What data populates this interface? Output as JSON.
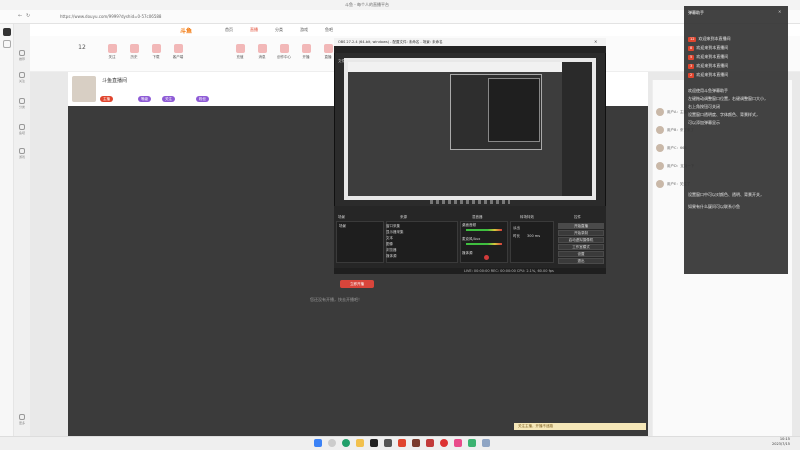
{
  "browser": {
    "tab_title": "斗鱼 - 每个人的直播平台",
    "url": "https://www.douyu.com/9999?dyshid=0-57c06588",
    "window_controls": [
      "—",
      "□",
      "✕"
    ]
  },
  "site": {
    "logo": "斗鱼",
    "nav": [
      "首页",
      "直播",
      "分类",
      "游戏",
      "鱼吧"
    ],
    "toolbar": [
      "12",
      "关注",
      "历史",
      "下载",
      "客户端",
      "充值",
      "消息",
      "创作中心",
      "开播",
      "直播"
    ],
    "sidebar": [
      "推荐",
      "关注",
      "分类",
      "鱼吧",
      "游戏",
      "更多"
    ]
  },
  "streamer": {
    "room_name": "斗鱼直播间",
    "tags": [
      "主播",
      "等级",
      "关注",
      "粉丝"
    ]
  },
  "stage": {
    "button": "立即开播",
    "message": "您还没有开播，快去开播吧！"
  },
  "obs": {
    "title": "OBS 27.2.4 (64-bit, windows) - 配置文件: 未命名 - 场景: 未命名",
    "menu": [
      "文件(F)",
      "编辑(E)",
      "视图(V)",
      "停靠部件(D)",
      "配置文件(P)",
      "场景集合(S)",
      "工具(T)",
      "帮助(H)"
    ],
    "docks": [
      "场景",
      "来源",
      "混音器",
      "转场特效",
      "控件"
    ],
    "scene": "场景",
    "sources": [
      "窗口采集",
      "显示器采集",
      "文本",
      "图像",
      "浏览器",
      "媒体源"
    ],
    "mixer": [
      "桌面音频",
      "麦克风/Aux",
      "媒体源"
    ],
    "transition": [
      "淡出",
      "时长"
    ],
    "transition_value": "300 ms",
    "controls": [
      "开始直播",
      "开始录制",
      "启动虚拟摄像机",
      "工作室模式",
      "设置",
      "退出"
    ],
    "status": "LIVE: 00:00:00   REC: 00:00:00   CPU: 2.1%, 60.00 fps"
  },
  "danmaku": {
    "header": "弹幕助手",
    "lines": [
      {
        "badge": "12",
        "text": "欢迎来到本直播间"
      },
      {
        "badge": "8",
        "text": "欢迎来到本直播间"
      },
      {
        "badge": "5",
        "text": "欢迎来到本直播间"
      },
      {
        "badge": "3",
        "text": "欢迎来到本直播间"
      },
      {
        "badge": "2",
        "text": "欢迎来到本直播间"
      }
    ],
    "notes": [
      "欢迎使用斗鱼弹幕助手",
      "左键拖动调整窗口位置，右键调整窗口大小，",
      "右上角按钮可关闭",
      "设置窗口透明度、字体颜色、背景样式，",
      "可以添加弹幕显示",
      "设置窗口中可以对颜色、透明、背景开关，",
      "如果有什么疑问可以联系小鱼"
    ]
  },
  "chat": {
    "rows": [
      "用户A：主播好",
      "用户B：来了来了",
      "用户C：666",
      "用户D：支持一下",
      "用户E：关注了"
    ]
  },
  "bottom_strip": "关注主播，开播不迷路",
  "clock": {
    "time": "10:15",
    "date": "2023/7/15"
  },
  "colors": {
    "accent": "#e0452e",
    "obs_bg": "#2b2b2b"
  }
}
